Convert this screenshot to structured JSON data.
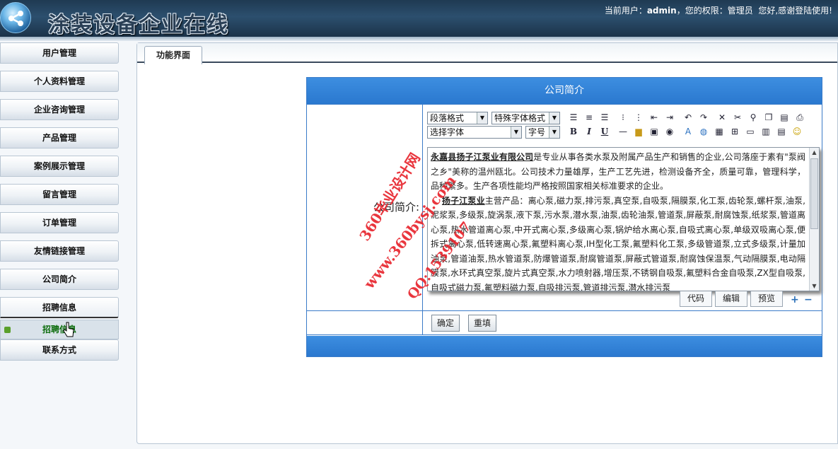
{
  "header": {
    "title": "涂装设备企业在线",
    "user_prefix": "当前用户：",
    "user_name": "admin",
    "role_prefix": "，您的权限：",
    "role": "管理员",
    "greeting": "您好,感谢登陆使用!"
  },
  "sidebar": {
    "items": [
      {
        "label": "用户管理"
      },
      {
        "label": "个人资料管理"
      },
      {
        "label": "企业咨询管理"
      },
      {
        "label": "产品管理"
      },
      {
        "label": "案例展示管理"
      },
      {
        "label": "留言管理"
      },
      {
        "label": "订单管理"
      },
      {
        "label": "友情链接管理"
      },
      {
        "label": "公司简介"
      },
      {
        "label": "招聘信息"
      },
      {
        "label": "联系方式"
      }
    ],
    "sub_item": {
      "label": "招聘信息"
    }
  },
  "main": {
    "tab_label": "功能界面",
    "form": {
      "heading": "公司简介",
      "field_label": "公司简介:",
      "editor": {
        "paragraph_format": "段落格式",
        "special_font": "特殊字体格式",
        "font_select": "选择字体",
        "font_size": "字号",
        "content_company": "永嘉县扬子江泵业有限公司",
        "content_p1": "是专业从事各类水泵及附属产品生产和销售的企业,公司落座于素有\"泵阀之乡\"美称的温州瓯北。公司技术力量雄厚，生产工艺先进，检测设备齐全，质量可靠，管理科学，品种繁多。生产各项性能均严格按照国家相关标准要求的企业。",
        "content_company_short": "扬子江泵业",
        "content_p2": "主营产品：离心泵,磁力泵,排污泵,真空泵,自吸泵,隔膜泵,化工泵,齿轮泵,螺杆泵,油泵,泥浆泵,多级泵,旋涡泵,液下泵,污水泵,潜水泵,油泵,齿轮油泵,管道泵,屏蔽泵,耐腐蚀泵,纸浆泵,管道离心泵,热水管道离心泵,中开式离心泵,多级离心泵,锅炉给水离心泵,自吸式离心泵,单级双吸离心泵,便拆式离心泵,低转速离心泵,氟塑料离心泵,IH型化工泵,氟塑料化工泵,多级管道泵,立式多级泵,计量加油泵,管道油泵,热水管道泵,防爆管道泵,耐腐管道泵,屏蔽式管道泵,耐腐蚀保温泵,气动隔膜泵,电动隔膜泵,水环式真空泵,旋片式真空泵,水力喷射器,增压泵,不锈钢自吸泵,氟塑料合金自吸泵,ZX型自吸泵,自吸式磁力泵,氟塑料磁力泵,自吸排污泵,管道排污泵,潜水排污泵",
        "mode_code": "代码",
        "mode_edit": "编辑",
        "mode_preview": "预览"
      },
      "confirm_label": "确定",
      "reset_label": "重填"
    }
  },
  "watermark": {
    "line1": "360毕业设计网",
    "line2": "www.360bysj.com",
    "line3": "QQ:1539107"
  },
  "colors": {
    "accent": "#2a78cf",
    "header_bg": "#1f3a52",
    "watermark": "#e8262e"
  }
}
